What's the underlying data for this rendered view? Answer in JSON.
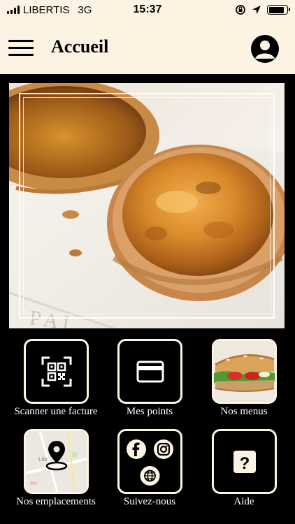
{
  "status_bar": {
    "carrier": "LIBERTIS",
    "network": "3G",
    "time": "15:37",
    "battery_level": 0.85
  },
  "header": {
    "title": "Accueil",
    "menu_icon": "hamburger-menu-icon",
    "account_icon": "user-account-icon"
  },
  "hero": {
    "image": "quiche-photo",
    "watermark_fragment": "PAI"
  },
  "tiles": [
    {
      "label": "Scanner une facture",
      "icon": "qr-code-icon"
    },
    {
      "label": "Mes points",
      "icon": "card-icon"
    },
    {
      "label": "Nos menus",
      "icon": "sandwich-photo"
    },
    {
      "label": "Nos emplacements",
      "icon": "map-pin-icon",
      "map_text": "Libr"
    },
    {
      "label": "Suivez-nous",
      "icon": "social-icons",
      "socials": [
        "facebook",
        "instagram",
        "website"
      ]
    },
    {
      "label": "Aide",
      "icon": "help-icon",
      "help_symbol": "?"
    }
  ],
  "colors": {
    "header_bg": "#fdf3e2",
    "page_bg": "#000000",
    "tile_border": "#fdf3e2",
    "text_light": "#ffffff"
  }
}
